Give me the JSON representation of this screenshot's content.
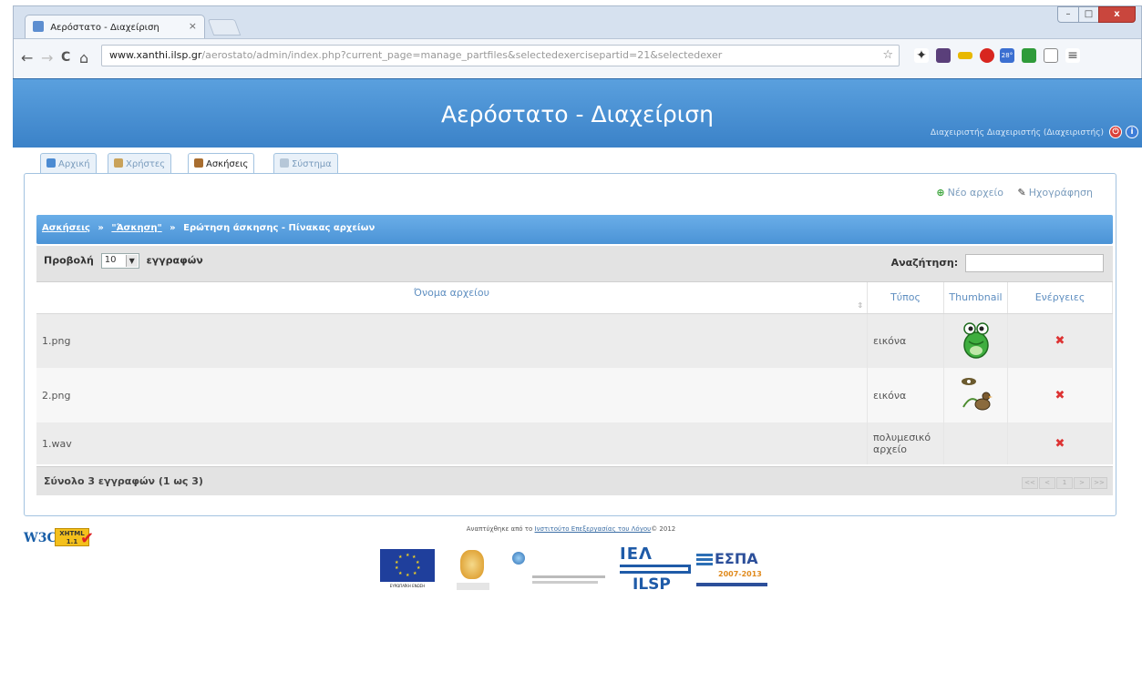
{
  "browser": {
    "tab_title": "Αερόστατο - Διαχείριση",
    "tab_close": "×",
    "url_host": "www.xanthi.ilsp.gr",
    "url_path": "/aerostato/admin/index.php?current_page=manage_partfiles&selectedexercisepartid=21&selectedexer",
    "window_minimize": "–",
    "window_maximize": "□",
    "window_close": "x",
    "nav_back": "←",
    "nav_forward": "→",
    "nav_reload": "C",
    "nav_home": "⌂",
    "star": "☆",
    "badge_count": "28°"
  },
  "header": {
    "title": "Αερόστατο - Διαχείριση",
    "admin_text": "Διαχειριστής Διαχειριστής (Διαχειριστής)",
    "logout_icon": "power",
    "info_icon": "info"
  },
  "nav_tabs": [
    {
      "label": "Αρχική"
    },
    {
      "label": "Χρήστες"
    },
    {
      "label": "Ασκήσεις"
    },
    {
      "label": "Σύστημα"
    }
  ],
  "actions": {
    "new_file": "Νέο αρχείο",
    "preview": "Ηχογράφηση",
    "new_file_glyph": "⊕",
    "preview_glyph": "✎"
  },
  "breadcrumb": {
    "item1": "Ασκήσεις",
    "item2": "\"Άσκηση\"",
    "item3": "Ερώτηση άσκησης - Πίνακας αρχείων",
    "separator": "»"
  },
  "datatable": {
    "length_prefix": "Προβολή",
    "length_value": "10",
    "length_suffix": "εγγραφών",
    "search_label": "Αναζήτηση:",
    "columns": {
      "filename": "Όνομα αρχείου",
      "type": "Τύπος",
      "thumbnail": "Thumbnail",
      "actions": "Ενέργειες"
    },
    "rows": [
      {
        "name": "1.png",
        "type": "εικόνα",
        "thumb": "frog"
      },
      {
        "name": "2.png",
        "type": "εικόνα",
        "thumb": "duck"
      },
      {
        "name": "1.wav",
        "type": "πολυμεσικό αρχείο",
        "thumb": ""
      }
    ],
    "summary": "Σύνολο 3 εγγραφών (1 ως 3)",
    "pager": [
      "<<",
      "<",
      "1",
      ">",
      ">>"
    ],
    "delete_glyph": "✖",
    "sort_glyph": "⇕"
  },
  "footer": {
    "w3c_text": "W3C",
    "xhtml_badge": "XHTML 1.1",
    "dev_prefix": "Αναπτύχθηκε από το",
    "dev_link": "Ινστιτούτο Επεξεργασίας του Λόγου",
    "dev_suffix": "© 2012",
    "ielsp_top": "ΙΕΛ",
    "ielsp_bottom": "ILSP",
    "espa": "ΕΣΠΑ",
    "espa_years": "2007-2013",
    "eu_caption": "ΕΥΡΩΠΑΪΚΗ ΕΝΩΣΗ"
  },
  "colors": {
    "header_blue": "#3b82c8",
    "bar_blue": "#4b93d6",
    "link_blue": "#5e8ec0",
    "delete_red": "#dd3333"
  }
}
